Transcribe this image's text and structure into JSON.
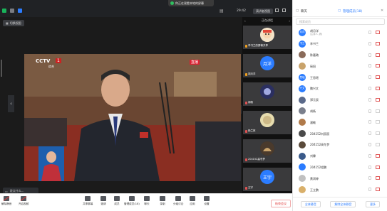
{
  "topbar": {
    "recording_banner": "你正在观看本地的屏幕",
    "clock": "29:42",
    "speaker_view": "演讲者视图"
  },
  "video": {
    "switch_label": "切换视图",
    "chat_placeholder": "说点什么..."
  },
  "stage": {
    "channel_logo": "CCTV",
    "channel_number": "1",
    "channel_sub": "综合",
    "live_tag": "直播"
  },
  "strip": {
    "header": "正在讲话",
    "tiles": [
      {
        "name": "李书兰的屏幕共享",
        "avatar": "cartoon"
      },
      {
        "name": "胡月洋",
        "avatar_text": "月洋"
      },
      {
        "name": "胡杨",
        "avatar": "photo"
      },
      {
        "name": "杨兰林",
        "avatar": "photo"
      },
      {
        "name": "204152高冬梦",
        "avatar": "photo"
      },
      {
        "name": "王宇",
        "avatar_text": "王宇"
      }
    ]
  },
  "panel": {
    "tab_chat": "聊天",
    "tab_manage": "管理成员(18)",
    "search_placeholder": "搜索成员",
    "participants": [
      {
        "name": "胡月洋",
        "sub": "(主持人, 我)",
        "avatar_text": "月洋",
        "color": "#2b7cff",
        "cam": "off"
      },
      {
        "name": "李书兰",
        "sub": "",
        "avatar_text": "书兰",
        "color": "#2b7cff",
        "cam": "off"
      },
      {
        "name": "陈嘉璐",
        "sub": "",
        "avatar_text": "",
        "color": "#8a6b5a",
        "cam": "off"
      },
      {
        "name": "瑶阳",
        "sub": "",
        "avatar_text": "",
        "color": "#c9a36b",
        "cam": "off"
      },
      {
        "name": "王思瑶",
        "sub": "",
        "avatar_text": "思瑶",
        "color": "#2b7cff",
        "cam": "off"
      },
      {
        "name": "魏兴文",
        "sub": "",
        "avatar_text": "兴文",
        "color": "#2b7cff",
        "cam": "off"
      },
      {
        "name": "郑元辰",
        "sub": "",
        "avatar_text": "",
        "color": "#5b6a8a",
        "cam": "off"
      },
      {
        "name": "胡杨",
        "sub": "",
        "avatar_text": "",
        "color": "#7a7f8c",
        "cam": "on"
      },
      {
        "name": "潘敏",
        "sub": "",
        "avatar_text": "",
        "color": "#b07a4a",
        "cam": "on"
      },
      {
        "name": "204152刘丽丽",
        "sub": "",
        "avatar_text": "",
        "color": "#4a4a4a",
        "cam": "on"
      },
      {
        "name": "204152高冬梦",
        "sub": "",
        "avatar_text": "",
        "color": "#5a4a3a",
        "cam": "on"
      },
      {
        "name": "刘霖",
        "sub": "",
        "avatar_text": "",
        "color": "#3a5a8a",
        "cam": "off"
      },
      {
        "name": "204152程鹏",
        "sub": "",
        "avatar_text": "",
        "color": "#2b7cff",
        "cam": "off"
      },
      {
        "name": "黄润婷",
        "sub": "",
        "avatar_text": "",
        "color": "#c0c0c0",
        "cam": "off"
      },
      {
        "name": "王立鹏",
        "sub": "",
        "avatar_text": "",
        "color": "#d9b06b",
        "cam": "off"
      }
    ],
    "mute_all": "全体静音",
    "unmute_all": "解除全体静音",
    "more": "更多"
  },
  "toolbar": {
    "items": [
      {
        "label": "解除静音",
        "icon": "mic-off-icon",
        "red": true
      },
      {
        "label": "开启视频",
        "icon": "camera-off-icon",
        "red": true
      },
      {
        "label": "共享屏幕",
        "icon": "share-screen-icon"
      },
      {
        "label": "邀请",
        "icon": "invite-icon"
      },
      {
        "label": "成员",
        "icon": "members-icon"
      },
      {
        "label": "管理成员(18)",
        "icon": "manage-members-icon"
      },
      {
        "label": "聊天",
        "icon": "chat-icon"
      },
      {
        "label": "录制",
        "icon": "record-icon"
      },
      {
        "label": "分组讨论",
        "icon": "breakout-icon"
      },
      {
        "label": "应用",
        "icon": "apps-icon"
      },
      {
        "label": "设置",
        "icon": "settings-icon"
      }
    ],
    "end_label": "结束会议"
  }
}
